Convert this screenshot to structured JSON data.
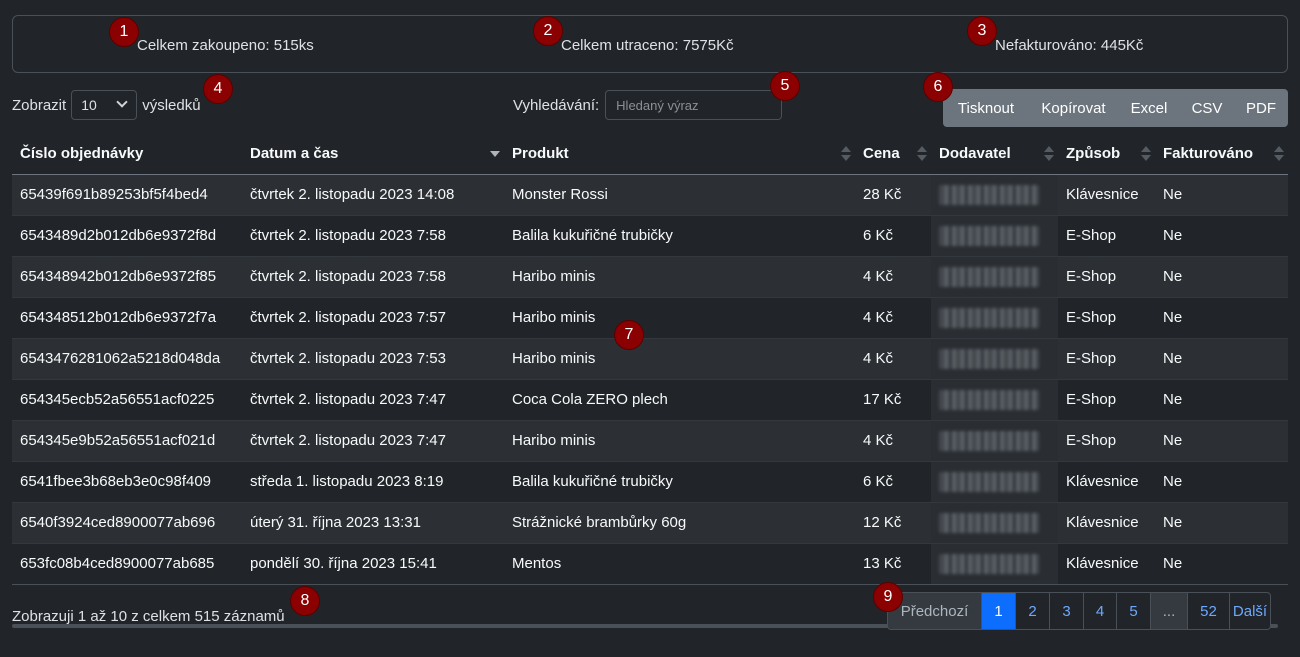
{
  "summary": {
    "total_bought": "Celkem zakoupeno: 515ks",
    "total_spent": "Celkem utraceno: 7575Kč",
    "not_invoiced": "Nefakturováno: 445Kč"
  },
  "markers": [
    "1",
    "2",
    "3",
    "4",
    "5",
    "6",
    "7",
    "8",
    "9"
  ],
  "length": {
    "prefix": "Zobrazit",
    "value": "10",
    "suffix": "výsledků"
  },
  "search": {
    "label": "Vyhledávání:",
    "placeholder": "Hledaný výraz"
  },
  "buttons": {
    "print": "Tisknout",
    "copy": "Kopírovat",
    "excel": "Excel",
    "csv": "CSV",
    "pdf": "PDF"
  },
  "table": {
    "headers": [
      "Číslo objednávky",
      "Datum a čas",
      "Produkt",
      "Cena",
      "Dodavatel",
      "Způsob",
      "Fakturováno"
    ],
    "sorted_column": "Datum a čas",
    "sort_direction": "desc",
    "rows": [
      [
        "65439f691b89253bf5f4bed4",
        "čtvrtek 2. listopadu 2023 14:08",
        "Monster Rossi",
        "28 Kč",
        "Klávesnice",
        "Ne"
      ],
      [
        "6543489d2b012db6e9372f8d",
        "čtvrtek 2. listopadu 2023 7:58",
        "Balila kukuřičné trubičky",
        "6 Kč",
        "E-Shop",
        "Ne"
      ],
      [
        "654348942b012db6e9372f85",
        "čtvrtek 2. listopadu 2023 7:58",
        "Haribo minis",
        "4 Kč",
        "E-Shop",
        "Ne"
      ],
      [
        "654348512b012db6e9372f7a",
        "čtvrtek 2. listopadu 2023 7:57",
        "Haribo minis",
        "4 Kč",
        "E-Shop",
        "Ne"
      ],
      [
        "6543476281062a5218d048da",
        "čtvrtek 2. listopadu 2023 7:53",
        "Haribo minis",
        "4 Kč",
        "E-Shop",
        "Ne"
      ],
      [
        "654345ecb52a56551acf0225",
        "čtvrtek 2. listopadu 2023 7:47",
        "Coca Cola ZERO plech",
        "17 Kč",
        "E-Shop",
        "Ne"
      ],
      [
        "654345e9b52a56551acf021d",
        "čtvrtek 2. listopadu 2023 7:47",
        "Haribo minis",
        "4 Kč",
        "E-Shop",
        "Ne"
      ],
      [
        "6541fbee3b68eb3e0c98f409",
        "středa 1. listopadu 2023 8:19",
        "Balila kukuřičné trubičky",
        "6 Kč",
        "Klávesnice",
        "Ne"
      ],
      [
        "6540f3924ced8900077ab696",
        "úterý 31. října 2023 13:31",
        "Strážnické brambůrky 60g",
        "12 Kč",
        "Klávesnice",
        "Ne"
      ],
      [
        "653fc08b4ced8900077ab685",
        "pondělí 30. října 2023 15:41",
        "Mentos",
        "13 Kč",
        "Klávesnice",
        "Ne"
      ]
    ]
  },
  "info": "Zobrazuji 1 až 10 z celkem 515 záznamů",
  "pagination": {
    "prev": "Předchozí",
    "pages": [
      "1",
      "2",
      "3",
      "4",
      "5",
      "...",
      "52"
    ],
    "active": "1",
    "next": "Další"
  },
  "colors": {
    "accent": "#0d6efd",
    "marker": "#8b0000",
    "background": "#212529"
  }
}
